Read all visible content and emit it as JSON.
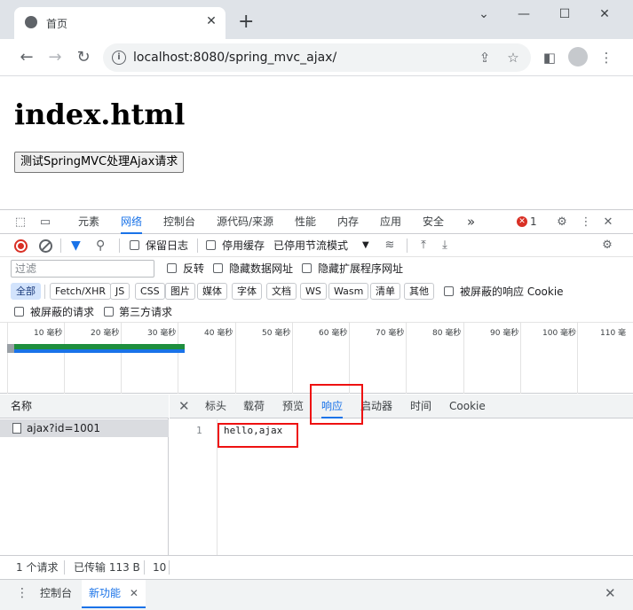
{
  "browser": {
    "tab_title": "首页",
    "tab_close": "✕",
    "new_tab": "+",
    "window_controls": [
      "⌄",
      "—",
      "☐",
      "✕"
    ],
    "url": "localhost:8080/spring_mvc_ajax/"
  },
  "page": {
    "heading": "index.html",
    "button": "测试SpringMVC处理Ajax请求"
  },
  "devtools": {
    "tabs": [
      "元素",
      "网络",
      "控制台",
      "源代码/来源",
      "性能",
      "内存",
      "应用",
      "安全"
    ],
    "more_tabs": "»",
    "active_tab": "网络",
    "error_count": "1",
    "toolbar": {
      "preserve_log": "保留日志",
      "disable_cache": "停用缓存",
      "throttling": "已停用节流模式"
    },
    "filter": {
      "placeholder": "过滤",
      "invert": "反转",
      "hide_data_urls": "隐藏数据网址",
      "hide_extension_urls": "隐藏扩展程序网址"
    },
    "type_chips": [
      "全部",
      "Fetch/XHR",
      "JS",
      "CSS",
      "图片",
      "媒体",
      "字体",
      "文档",
      "WS",
      "Wasm",
      "清单",
      "其他"
    ],
    "blocked_cookies": "被屏蔽的响应 Cookie",
    "blocked_requests": "被屏蔽的请求",
    "third_party": "第三方请求",
    "timeline_labels": [
      "10 毫秒",
      "20 毫秒",
      "30 毫秒",
      "40 毫秒",
      "50 毫秒",
      "60 毫秒",
      "70 毫秒",
      "80 毫秒",
      "90 毫秒",
      "100 毫秒",
      "110 毫"
    ],
    "name_header": "名称",
    "requests": [
      {
        "name": "ajax?id=1001"
      }
    ],
    "detail_tabs": [
      "标头",
      "载荷",
      "预览",
      "响应",
      "启动器",
      "时间",
      "Cookie"
    ],
    "active_detail_tab": "响应",
    "response": {
      "line_number": "1",
      "body": "hello,ajax"
    },
    "status": {
      "requests": "1 个请求",
      "transferred": "已传输 113 B",
      "extra": "10"
    },
    "drawer_tabs": [
      "控制台",
      "新功能"
    ],
    "active_drawer_tab": "新功能"
  },
  "colors": {
    "accent": "#1a73e8",
    "highlight": "#ee1111",
    "error": "#d93025"
  }
}
